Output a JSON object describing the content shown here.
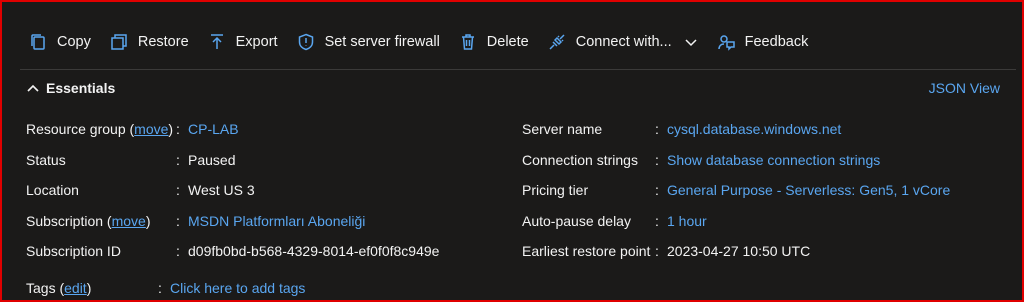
{
  "toolbar": {
    "copy": "Copy",
    "restore": "Restore",
    "export": "Export",
    "firewall": "Set server firewall",
    "delete": "Delete",
    "connect": "Connect with...",
    "feedback": "Feedback"
  },
  "essentials": {
    "title": "Essentials",
    "json_view": "JSON View"
  },
  "left": {
    "resource_group": {
      "key_prefix": "Resource group (",
      "link": "move",
      "key_suffix": ")",
      "sep": ":",
      "value": "CP-LAB"
    },
    "status": {
      "key": "Status",
      "sep": ":",
      "value": "Paused"
    },
    "location": {
      "key": "Location",
      "sep": ":",
      "value": "West US 3"
    },
    "subscription": {
      "key_prefix": "Subscription (",
      "link": "move",
      "key_suffix": ")",
      "sep": ":",
      "value": "MSDN Platformları Aboneliği"
    },
    "subscription_id": {
      "key": "Subscription ID",
      "sep": ":",
      "value": "d09fb0bd-b568-4329-8014-ef0f0f8c949e"
    }
  },
  "right": {
    "server_name": {
      "key": "Server name",
      "sep": ":",
      "value": "cysql.database.windows.net"
    },
    "connection_strings": {
      "key": "Connection strings",
      "sep": ":",
      "value": "Show database connection strings"
    },
    "pricing_tier": {
      "key": "Pricing tier",
      "sep": ":",
      "value": "General Purpose - Serverless: Gen5, 1 vCore"
    },
    "auto_pause": {
      "key": "Auto-pause delay",
      "sep": ":",
      "value": "1 hour"
    },
    "restore_point": {
      "key": "Earliest restore point",
      "sep": ":",
      "value": "2023-04-27 10:50 UTC"
    }
  },
  "tags": {
    "key_prefix": "Tags (",
    "link": "edit",
    "key_suffix": ")",
    "sep": ":",
    "value": "Click here to add tags"
  },
  "icons": {
    "copy": "copy-icon",
    "restore": "restore-icon",
    "export": "export-icon",
    "firewall": "shield-icon",
    "delete": "trash-icon",
    "connect": "plug-icon",
    "chevron": "chevron-down-icon",
    "feedback": "feedback-icon",
    "caret": "chevron-up-icon"
  },
  "colors": {
    "accent": "#5aa6f0",
    "background": "#1b1a19",
    "frame": "#e00000"
  }
}
